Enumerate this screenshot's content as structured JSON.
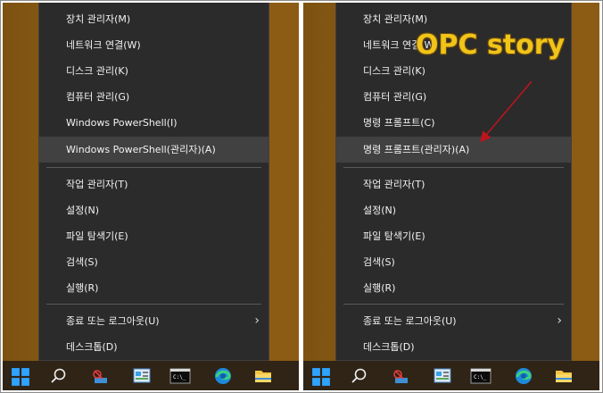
{
  "left_menu": {
    "items": [
      {
        "label": "장치 관리자(M)"
      },
      {
        "label": "네트워크 연결(W)"
      },
      {
        "label": "디스크 관리(K)"
      },
      {
        "label": "컴퓨터 관리(G)"
      },
      {
        "label": "Windows PowerShell(I)"
      },
      {
        "label": "Windows PowerShell(관리자)(A)"
      },
      {
        "label": "작업 관리자(T)"
      },
      {
        "label": "설정(N)"
      },
      {
        "label": "파일 탐색기(E)"
      },
      {
        "label": "검색(S)"
      },
      {
        "label": "실행(R)"
      },
      {
        "label": "종료 또는 로그아웃(U)"
      },
      {
        "label": "데스크톱(D)"
      }
    ],
    "highlighted": "Windows PowerShell(관리자)(A)"
  },
  "right_menu": {
    "items": [
      {
        "label": "장치 관리자(M)"
      },
      {
        "label": "네트워크 연결(W)"
      },
      {
        "label": "디스크 관리(K)"
      },
      {
        "label": "컴퓨터 관리(G)"
      },
      {
        "label": "명령 프롬프트(C)"
      },
      {
        "label": "명령 프롬프트(관리자)(A)"
      },
      {
        "label": "작업 관리자(T)"
      },
      {
        "label": "설정(N)"
      },
      {
        "label": "파일 탐색기(E)"
      },
      {
        "label": "검색(S)"
      },
      {
        "label": "실행(R)"
      },
      {
        "label": "종료 또는 로그아웃(U)"
      },
      {
        "label": "데스크톱(D)"
      }
    ],
    "highlighted": "명령 프롬프트(관리자)(A)"
  },
  "watermark": "OPC story",
  "taskbar_icons": [
    "windows-start-icon",
    "search-icon",
    "snipping-tool-icon",
    "control-panel-icon",
    "command-prompt-icon",
    "edge-browser-icon",
    "file-explorer-icon"
  ],
  "colors": {
    "menu_bg": "#2b2b2b",
    "highlight_bg": "#414141",
    "desktop": "#8c5b15",
    "watermark": "#f0c419",
    "arrow": "#c0141c"
  }
}
